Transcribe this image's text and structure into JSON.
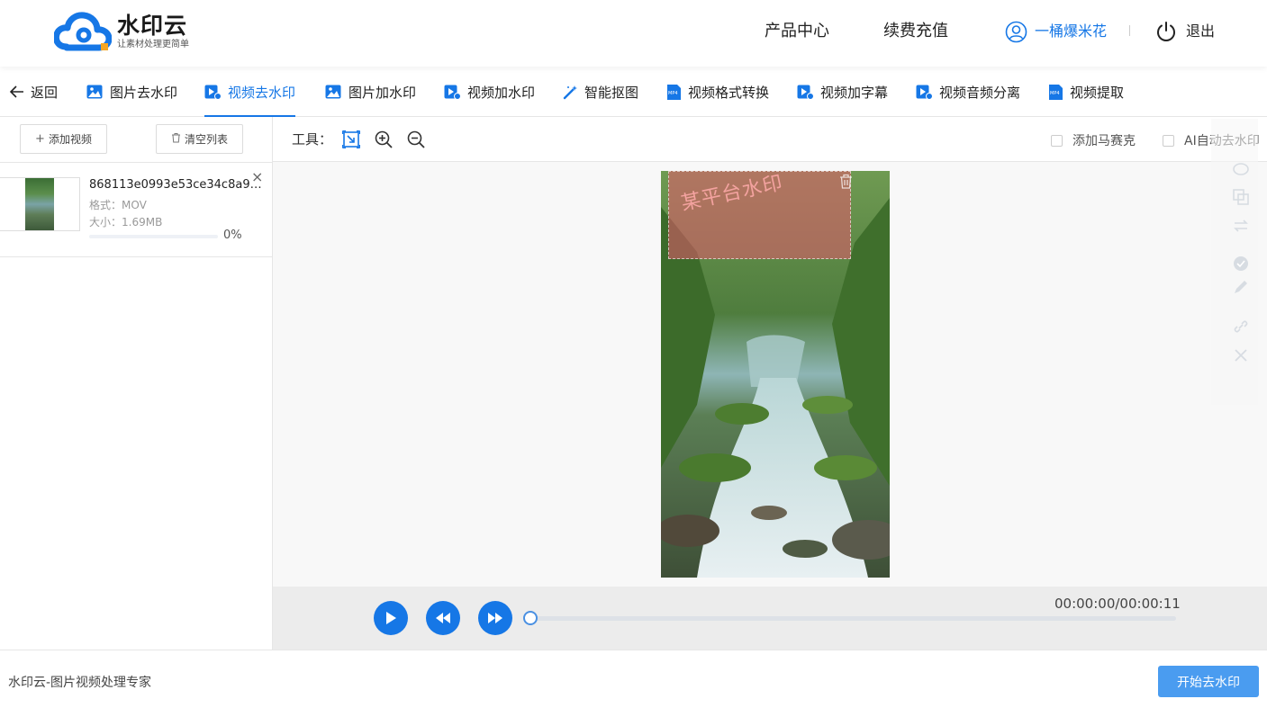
{
  "header": {
    "logo_name": "水印云",
    "logo_slogan": "让素材处理更简单",
    "nav": [
      "产品中心",
      "续费充值"
    ],
    "username": "一桶爆米花",
    "logout_label": "退出"
  },
  "tabs": {
    "back_label": "返回",
    "items": [
      "图片去水印",
      "视频去水印",
      "图片加水印",
      "视频加水印",
      "智能抠图",
      "视频格式转换",
      "视频加字幕",
      "视频音频分离",
      "视频提取"
    ],
    "active_label": "视频去水印",
    "mp4_badge": "MP4"
  },
  "sidebar": {
    "add_label": "添加视频",
    "clear_label": "清空列表",
    "file": {
      "name": "868113e0993e53ce34c8a947...",
      "format": "格式：MOV",
      "size": "大小：1.69MB",
      "progress_label": "0%",
      "progress": 0
    }
  },
  "toolbar": {
    "label": "工具：",
    "checkboxes": [
      "添加马赛克",
      "AI自动去水印"
    ]
  },
  "preview": {
    "watermark_text": "某平台水印"
  },
  "player": {
    "time": "00:00:00/00:00:11",
    "progress": 0
  },
  "footer": {
    "text": "水印云-图片视频处理专家",
    "start_label": "开始去水印"
  },
  "colors": {
    "accent": "#1677e6",
    "start_button": "#4a9cf0",
    "selection": "#e65a6e"
  }
}
